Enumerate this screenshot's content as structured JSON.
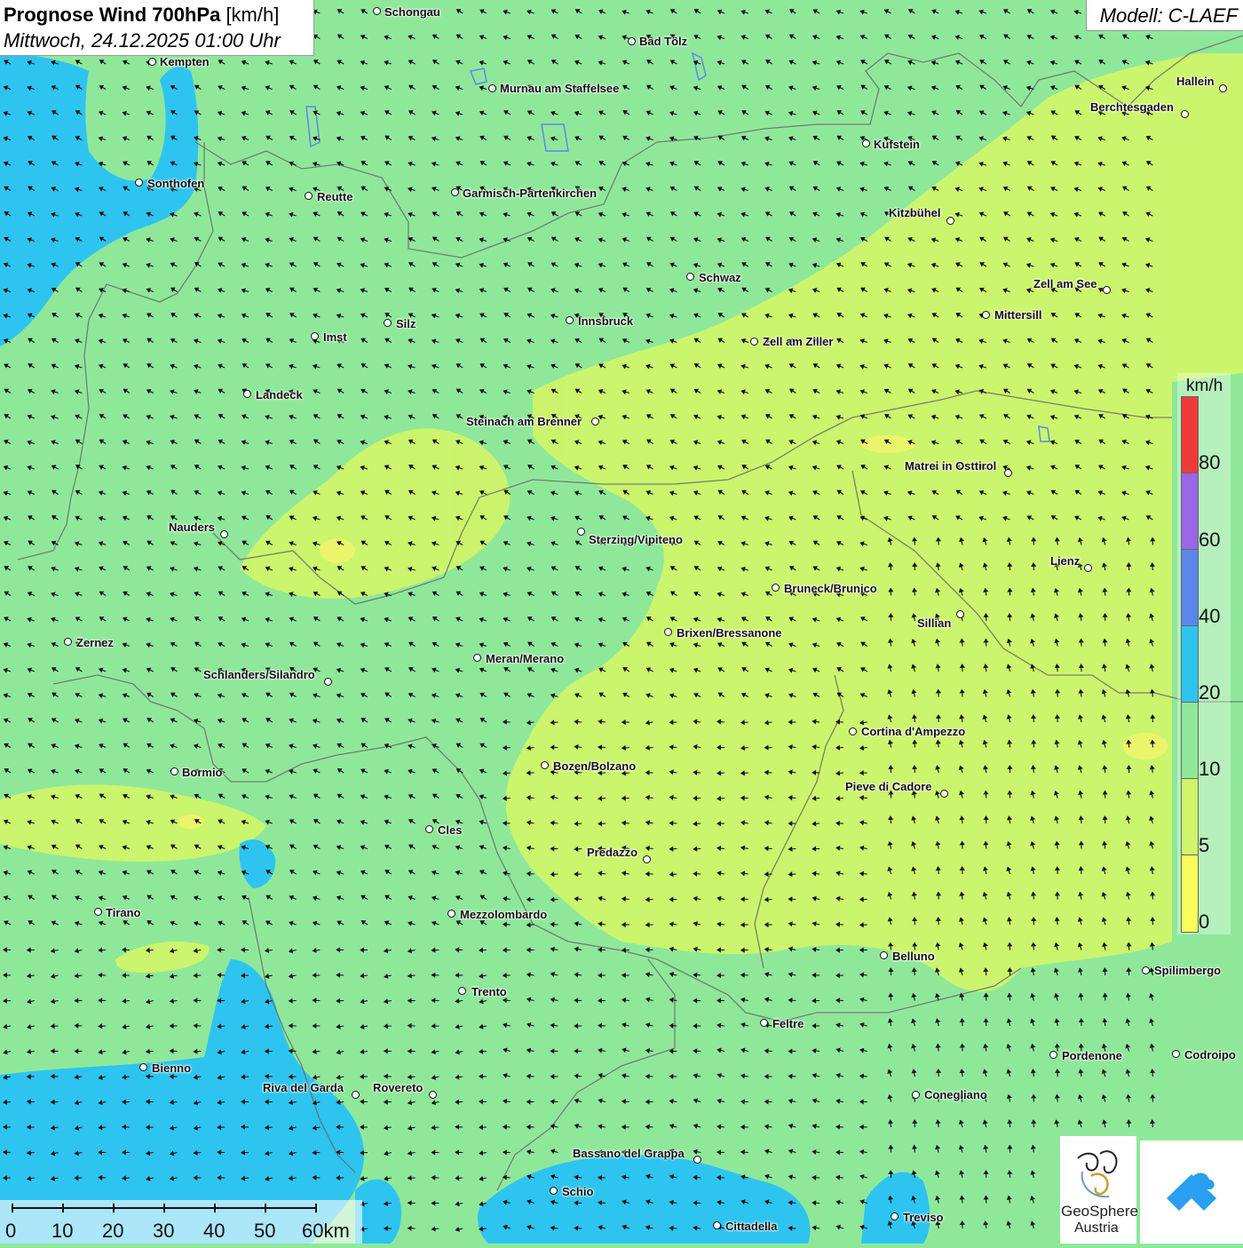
{
  "header": {
    "title_bold": "Prognose Wind 700hPa",
    "title_unit": "[km/h]",
    "datetime": "Mittwoch, 24.12.2025 01:00 Uhr",
    "model": "Modell: C-LAEF"
  },
  "legend": {
    "unit": "km/h",
    "classes": [
      {
        "label": "0",
        "color": "#fcfc5a"
      },
      {
        "label": "5",
        "color": "#cff56a"
      },
      {
        "label": "10",
        "color": "#8fe89a"
      },
      {
        "label": "20",
        "color": "#2ec4f0"
      },
      {
        "label": "40",
        "color": "#5b88e8"
      },
      {
        "label": "60",
        "color": "#9966e6"
      },
      {
        "label": "80",
        "color": "#ee3a3a"
      }
    ]
  },
  "scale_bar": {
    "labels": [
      "0",
      "10",
      "20",
      "30",
      "40",
      "50",
      "60km"
    ]
  },
  "logos": {
    "geosphere_line1": "GeoSphere",
    "geosphere_line2": "Austria"
  },
  "cities": [
    {
      "name": "Schongau"
    },
    {
      "name": "Bad Tölz"
    },
    {
      "name": "Kempten"
    },
    {
      "name": "Murnau am Staffelsee"
    },
    {
      "name": "Hallein"
    },
    {
      "name": "Berchtesgaden"
    },
    {
      "name": "Kufstein"
    },
    {
      "name": "Sonthofen"
    },
    {
      "name": "Reutte"
    },
    {
      "name": "Garmisch-Partenkirchen"
    },
    {
      "name": "Kitzbühel"
    },
    {
      "name": "Schwaz"
    },
    {
      "name": "Zell am See"
    },
    {
      "name": "Mittersill"
    },
    {
      "name": "Silz"
    },
    {
      "name": "Innsbruck"
    },
    {
      "name": "Imst"
    },
    {
      "name": "Zell am Ziller"
    },
    {
      "name": "Landeck"
    },
    {
      "name": "Steinach am Brenner"
    },
    {
      "name": "Matrei in Osttirol"
    },
    {
      "name": "Nauders"
    },
    {
      "name": "Sterzing/Vipiteno"
    },
    {
      "name": "Lienz"
    },
    {
      "name": "Bruneck/Brunico"
    },
    {
      "name": "Sillian"
    },
    {
      "name": "Brixen/Bressanone"
    },
    {
      "name": "Zernez"
    },
    {
      "name": "Meran/Merano"
    },
    {
      "name": "Schlanders/Silandro"
    },
    {
      "name": "Cortina d'Ampezzo"
    },
    {
      "name": "Bozen/Bolzano"
    },
    {
      "name": "Bormio"
    },
    {
      "name": "Pieve di Cadore"
    },
    {
      "name": "Cles"
    },
    {
      "name": "Predazzo"
    },
    {
      "name": "Tirano"
    },
    {
      "name": "Mezzolombardo"
    },
    {
      "name": "Belluno"
    },
    {
      "name": "Spilimbergo"
    },
    {
      "name": "Trento"
    },
    {
      "name": "Feltre"
    },
    {
      "name": "Pordenone"
    },
    {
      "name": "Codroipo"
    },
    {
      "name": "Bienno"
    },
    {
      "name": "Riva del Garda"
    },
    {
      "name": "Rovereto"
    },
    {
      "name": "Conegliano"
    },
    {
      "name": "Bassano del Grappa"
    },
    {
      "name": "Schio"
    },
    {
      "name": "Treviso"
    },
    {
      "name": "Cittadella"
    }
  ]
}
